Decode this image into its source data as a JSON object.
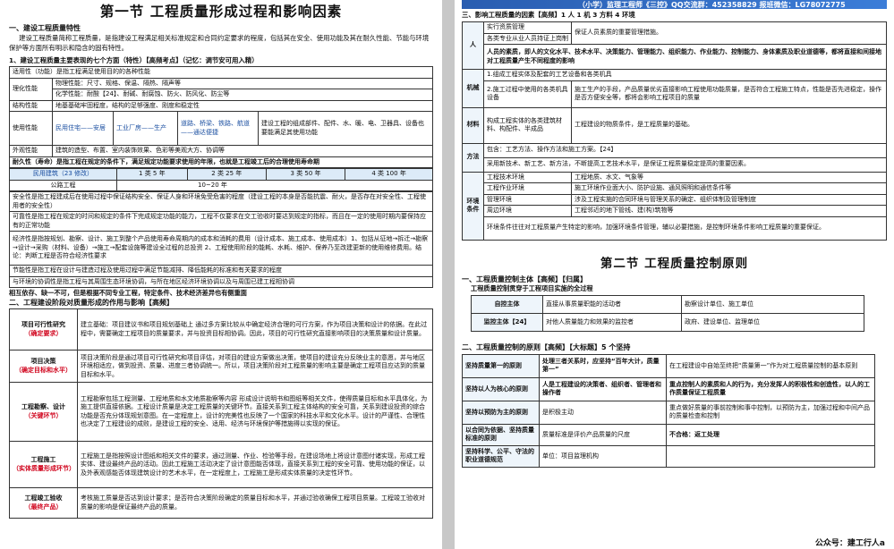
{
  "left": {
    "title": "第一节 工程质量形成过程和影响因素",
    "s1_heading": "一、建设工程质量特性",
    "s1_para": "建设工程质量简称工程质量，是指建设工程满足相关标准规定和合同约定要求的程度，包括其在安全、使用功能及其在耐久性能、节能与环境保护等方面所有明示和隐含的固有特性。",
    "s1_sub": "1、建设工程质量主要表现的七个方面（特性）【高频考点】（记忆：调节安可用入精）",
    "spec_table": {
      "r1": "适用性（功能）是指工程满足使用目的的各种性能",
      "r2a": "理化性能",
      "r2b": "物理性能：尺寸、规格、保温、隔热、隔声等",
      "r3b": "化学性能：耐酸【24】、耐碱、耐腐蚀、防火、防风化、防尘等",
      "r4a": "结构性能",
      "r4b": "地基基础牢固程度，结构的足够强度、刚度和稳定性",
      "r5a": "使用性能",
      "r5b": "民用住宅——安居",
      "r5c": "工业厂房——生产",
      "r5d": "道路、桥梁、铁路、航道——通达便捷",
      "r5e": "建设工程的组成部件、配件、水、暖、电、卫器具、设备也要能满足其使用功能",
      "r6a": "外观性能",
      "r6b": "建筑的造型、布置、室内装饰效果、色彩等美观大方、协调等",
      "r7": "耐久性（寿命）是指工程在规定的条件下，满足规定功能要求使用的年限，也就是工程竣工后的合理使用寿命期",
      "r8": [
        "民用建筑（23 修改）",
        "1 类 5 年",
        "2 类 25 年",
        "3 类 50 年",
        "4 类 100 年"
      ],
      "r9a": "公路工程",
      "r9b": "10~20 年",
      "r10": "安全性是指工程建成后在使用过程中保证结构安全、保证人身和环境免受危害的程度（建设工程的本身是否能抗震、耐火，是否存在对安全性、工程使用者的安全性）",
      "r11": "可靠性是指工程在规定的时间和规定的条件下完成规定功能的能力，工程不仅要求在交工验收时要达到规定的指标，而且在一定的使用时期内要保持应有的正常功能",
      "r12": "经济性是指按规划、勘察、设计、施工到整个产品使用寿命周期内的成本和消耗的费用（设计成本、施工成本、使用成本）1、包括从征地→拆迁→勘察→设计→采购（材料、设备）→施工→配套设施等建设全过程的总投资 2、工程使用阶段的能耗、水耗、维护、保养乃至改建更新的使用维修费用。结论：判断工程是否符合经济性要求",
      "r13": "节能性是指工程在设计与建造过程及使用过程中满足节能减排、降低能耗的标准和有关要求的程度",
      "r14": "与环境的协调性是指工程与其周围生态环境协调，与所在地区经济环境协调以及与周围已建工程相协调"
    },
    "summary": "相互依存、缺一不可，但是根据不同专业工程，特定条件、技术经济差异也有侧重面",
    "s2_heading": "二、工程建设阶段对质量形成的作用与影响【高频】",
    "stage_table": [
      {
        "name": "项目可行性研究",
        "tag": "（确定要求）",
        "text": "建立基础：项目建议书和项目规划基础上 通过多方案比较从中确定经济合理的可行方案，作为项目决策和设计的依据。在此过程中，需要确定工程项目的质量要求，并与投资目标相协调。因此，项目的可行性研究直接影响项目的决策质量和设计质量。"
      },
      {
        "name": "项目决策",
        "tag": "（确定目标和水平）",
        "text": "项目决策阶段是通过项目可行性研究和项目评估，对项目的建设方案做出决策，使项目的建设充分反映业主的意愿，并与地区环境相适应，做到投资、质量、进度三者协调统一。所以，项目决策阶段对工程质量的影响主要是确定工程项目应达到的质量目标和水平。"
      },
      {
        "name": "工程勘察、设计",
        "tag": "（关键环节）",
        "text": "工程勘察包括工程测量、工程地质和水文地质勘察等内容 形成设计说明书和图纸等相关文件，使得质量目标和水平具体化，为施工提供直接依据。工程设计质量是决定工程质量的关键环节。直接关系到工程主体结构的安全可靠，关系到建设投资的综合功能是否充分体现规划意图。在一定程度上，设计的完美性也反映了一个国家的科技水平和文化水平。设计的严谨性、合理性也决定了工程建设的成败，是建设工程的安全、适用、经济与环境保护等措施得以实现的保证。"
      },
      {
        "name": "工程施工",
        "tag": "（实体质量形成环节）",
        "text": "工程施工是指按照设计图纸和相关文件的要求，通过测量、作业、检验等手段，在建设场地上将设计意图付诸实现，形成工程实体、建设最终产品的活动。因此工程施工活动决定了设计意图能否体现，直接关系到工程的安全可靠、使用功能的保证，以及外表观感能否体现建筑设计的艺术水平，在一定程度上，工程施工是形成实体质量的决定性环节。"
      },
      {
        "name": "工程竣工验收",
        "tag": "（最终产品）",
        "text": "考核施工质量是否达到设计要求；是否符合决策阶段确定的质量目标和水平，并通过验收确保工程项目质量。工程竣工验收对质量的影响是保证最终产品的质量。"
      }
    ]
  },
  "right": {
    "banner": "（小学）监理工程师《三控》QQ交流群：452358829    报班微信：LG78072775",
    "s3_heading": "三、影响工程质量的因素【高频】1 人 1 机 3 方料 4 环境",
    "factor_table": {
      "man": "人",
      "man1": "实行资质管理",
      "man1b": "保证人员素质的重要管理措施。",
      "man2": "各类专业从业人员持证上岗制",
      "man3": "人员的素质，即人的文化水平、技术水平、决策能力、管理能力、组织能力、作业能力、控制能力、身体素质及职业道德等，都将直接和间接地对工程质量产生不同程度的影响",
      "mach": "机械",
      "mach1": "1.组成工程实体及配套的工艺设备和各类机具",
      "mach2": "2.施工过程中使用的各类机具设备",
      "mach2b": "施工生产的手段，产品质量优劣直接影响工程使用功能质量，是否符合工程施工特点，性能是否先进稳定，操作是否方便安全等，都将会影响工程项目的质量",
      "mat": "材料",
      "mat1": "构成工程实体的各类建筑材料、构配件、半成品",
      "mat1b": "工程建设的物质条件，是工程质量的基础。",
      "meth": "方法",
      "meth1": "包含：工艺方法、操作方法和施工方案。【24】",
      "meth2": "采用新技术、新工艺、新方法，不断提高工艺技术水平，是保证工程质量稳定提高的重要因素。",
      "env": "环境条件",
      "env_rows": [
        [
          "工程技术环境",
          "工程地质、水文、气象等"
        ],
        [
          "工程作业环境",
          "施工环境作业面大小、防护设施、通风照明和通信条件等"
        ],
        [
          "管理环境",
          "涉及工程实施的合同环境与管理关系的确定、组织体制及管理制度"
        ],
        [
          "周边环境",
          "工程邻近的地下管线、建(构)筑物等"
        ]
      ],
      "env_note": "环境条件往往对工程质量产生特定的影响，加强环境条件管理，辅以必要措施，是控制环境条件影响工程质量的重要保证。"
    },
    "title2": "第二节 工程质量控制原则",
    "s1_heading": "一、工程质量控制主体【高频】【归属】",
    "s1_sub": "工程质量控制贯穿于工程项目实施的全过程",
    "ctrl_table": [
      [
        "自控主体",
        "直接从事质量职能的活动者",
        "勘察设计单位、施工单位"
      ],
      [
        "监控主体【24】",
        "对他人质量能力和效果的监控者",
        "政府、建设单位、监理单位"
      ]
    ],
    "s2_heading": "二、工程质量控制的原则【高频】【大标题】5 个坚持",
    "prin_table": [
      [
        "坚持质量第一的原则",
        "处理三者关系时，应坚持“百年大计，质量第一”",
        "在工程建设中自始至终把“质量第一”作为对工程质量控制的基本原则"
      ],
      [
        "坚持以人为核心的原则",
        "人是工程建设的决策者、组织者、管理者和操作者",
        "重点控制人的素质和人的行为，充分发挥人的积极性和创造性，以人的工作质量保证工程质量"
      ],
      [
        "坚持以预防为主的原则",
        "是积极主动",
        "重点做好质量的事前控制和事中控制，以预防为主，加强过程和中间产品的质量检查和控制"
      ],
      [
        "以合同为依据、坚持质量标准的原则",
        "质量标准是评价产品质量的尺度",
        "不合格：返工处理"
      ],
      [
        "坚持科学、公平、守法的职业道德规范",
        "单位：项目监理机构",
        ""
      ]
    ],
    "footer": "公众号：建工行人a"
  }
}
